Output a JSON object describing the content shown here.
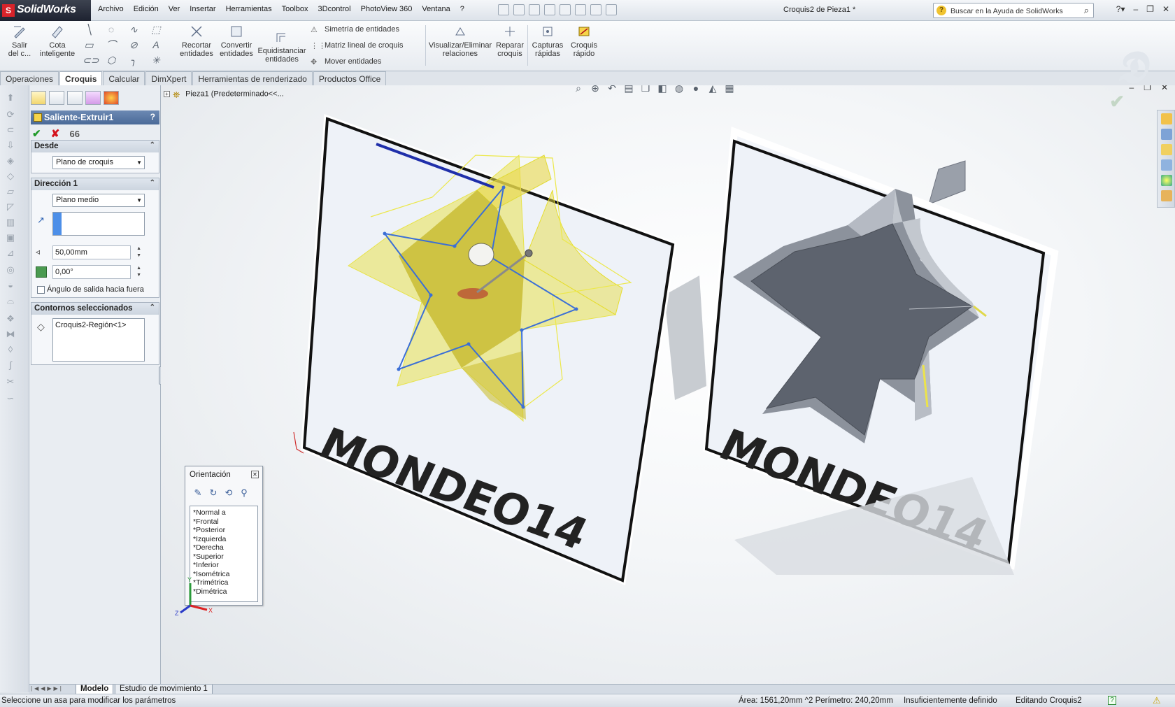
{
  "app": {
    "name": "SolidWorks",
    "doc_title": "Croquis2 de Pieza1 *"
  },
  "menu": [
    "Archivo",
    "Edición",
    "Ver",
    "Insertar",
    "Herramientas",
    "Toolbox",
    "3Dcontrol",
    "PhotoView 360",
    "Ventana",
    "?"
  ],
  "search": {
    "placeholder": "Buscar en la Ayuda de SolidWorks"
  },
  "toolbar": {
    "salir": "Salir\ndel c...",
    "cota": "Cota\ninteligente",
    "recortar": "Recortar\nentidades",
    "convertir": "Convertir\nentidades",
    "equidistanciar": "Equidistanciar\nentidades",
    "simetria": "Simetría de entidades",
    "matriz": "Matriz lineal de croquis",
    "mover": "Mover entidades",
    "visualizar": "Visualizar/Eliminar\nrelaciones",
    "reparar": "Reparar\ncroquis",
    "capturas": "Capturas\nrápidas",
    "croquis_rapido": "Croquis\nrápido"
  },
  "tabs": [
    "Operaciones",
    "Croquis",
    "Calcular",
    "DimXpert",
    "Herramientas de renderizado",
    "Productos Office"
  ],
  "tree": {
    "root": "Pieza1  (Predeterminado<<..."
  },
  "property_manager": {
    "title": "Saliente-Extruir1",
    "help": "?",
    "desde": {
      "header": "Desde",
      "value": "Plano de croquis"
    },
    "direccion1": {
      "header": "Dirección 1",
      "type": "Plano medio",
      "depth": "50,00mm",
      "angle": "0,00°",
      "draft_label": "Ángulo de salida hacia fuera"
    },
    "contornos": {
      "header": "Contornos seleccionados",
      "item": "Croquis2-Región<1>"
    }
  },
  "orientation": {
    "title": "Orientación",
    "views": [
      "*Normal a",
      "*Frontal",
      "*Posterior",
      "*Izquierda",
      "*Derecha",
      "*Superior",
      "*Inferior",
      "*Isométrica",
      "*Trimétrica",
      "*Dimétrica"
    ]
  },
  "viewport": {
    "label_text": "MONDEO14"
  },
  "triad": {
    "x": "X",
    "y": "Y",
    "z": "Z"
  },
  "bottom_tabs": [
    "Modelo",
    "Estudio de movimiento 1"
  ],
  "status": {
    "hint": "Seleccione un asa para modificar los parámetros",
    "measure": "Área: 1561,20mm ^2 Perímetro: 240,20mm",
    "defined": "Insuficientemente definido",
    "editing": "Editando Croquis2"
  },
  "colors": {
    "accent": "#4a6a98",
    "sketch_blue": "#3b6fd6",
    "preview_yellow": "#f2ea4a",
    "brand_red": "#d8232a"
  }
}
